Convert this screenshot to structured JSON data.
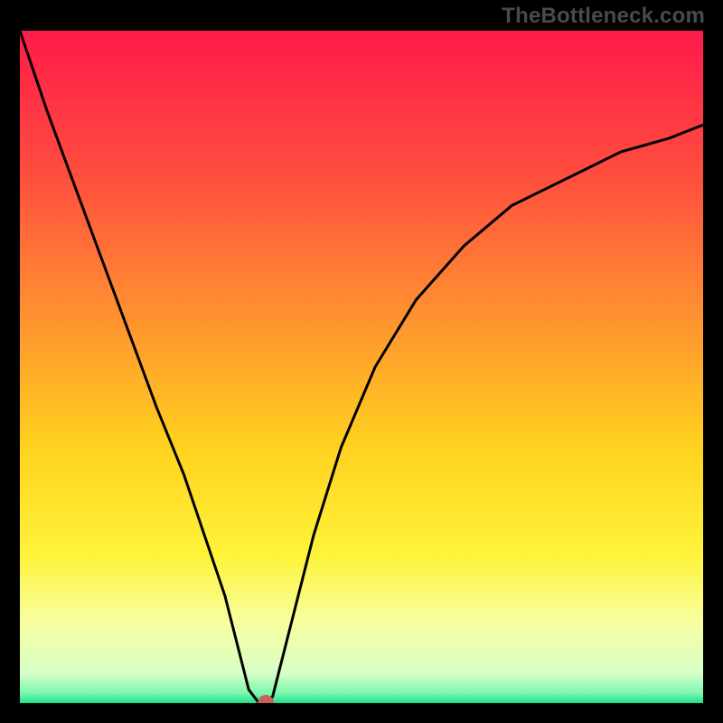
{
  "watermark": "TheBottleneck.com",
  "chart_data": {
    "type": "line",
    "title": "",
    "xlabel": "",
    "ylabel": "",
    "xlim": [
      0,
      100
    ],
    "ylim": [
      0,
      100
    ],
    "background_gradient": {
      "orientation": "vertical",
      "stops": [
        {
          "pos": 0.0,
          "color": "#ff1a4a"
        },
        {
          "pos": 0.22,
          "color": "#ff4f3e"
        },
        {
          "pos": 0.45,
          "color": "#ff9a2e"
        },
        {
          "pos": 0.62,
          "color": "#ffd21e"
        },
        {
          "pos": 0.78,
          "color": "#fff33a"
        },
        {
          "pos": 0.88,
          "color": "#f7ffa0"
        },
        {
          "pos": 0.955,
          "color": "#d8ffc8"
        },
        {
          "pos": 0.985,
          "color": "#7cf7b0"
        },
        {
          "pos": 1.0,
          "color": "#1fe08a"
        }
      ]
    },
    "series": [
      {
        "name": "bottleneck-curve",
        "color": "#000000",
        "x": [
          0,
          4,
          8,
          12,
          16,
          20,
          24,
          27,
          30,
          32,
          33.5,
          35,
          36,
          37,
          38,
          40,
          43,
          47,
          52,
          58,
          65,
          72,
          80,
          88,
          95,
          100
        ],
        "y": [
          100,
          88,
          77,
          66,
          55,
          44,
          34,
          25,
          16,
          8,
          2,
          0,
          0,
          1,
          5,
          13,
          25,
          38,
          50,
          60,
          68,
          74,
          78,
          82,
          84,
          86
        ]
      }
    ],
    "marker": {
      "name": "min-point",
      "x": 36,
      "y": 0,
      "color": "#c9605a",
      "radius_px": 9
    },
    "grid": false,
    "legend": false
  }
}
